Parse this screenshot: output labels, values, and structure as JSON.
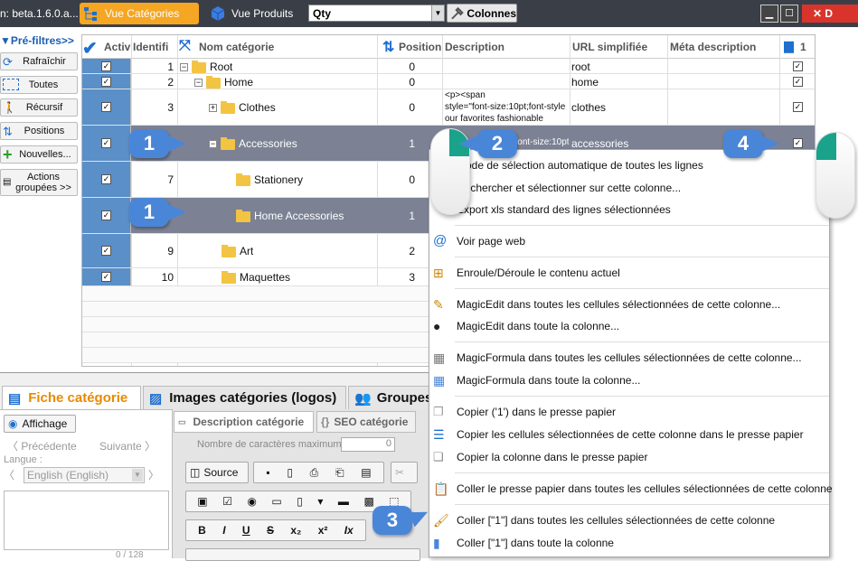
{
  "topbar": {
    "title": "n: beta.1.6.0.a...",
    "view_categories": "Vue Catégories",
    "view_products": "Vue Produits",
    "qty_value": "Qty",
    "columns_button": "Colonnes",
    "close_label": "D"
  },
  "left_panel": {
    "prefilters": "Pré-filtres>>",
    "refresh": "Rafraîchir",
    "all": "Toutes",
    "recursive": "Récursif",
    "positions": "Positions",
    "new": "Nouvelles...",
    "group_actions_1": "Actions",
    "group_actions_2": "groupées >>"
  },
  "grid": {
    "headers": {
      "activ": "Activ",
      "ident": "Identifi",
      "name": "Nom catégorie",
      "position": "Position",
      "description": "Description",
      "url": "URL simplifiée",
      "meta": "Méta description",
      "last": "1"
    },
    "rows": [
      {
        "id": "1",
        "name": "Root",
        "position": "0",
        "description": "",
        "url": "root"
      },
      {
        "id": "2",
        "name": "Home",
        "position": "0",
        "description": "",
        "url": "home"
      },
      {
        "id": "3",
        "name": "Clothes",
        "position": "0",
        "description_l1": "<p><span",
        "description_l2": "style=\"font-size:10pt;font-style",
        "description_l3": "our favorites fashionable",
        "url": "clothes"
      },
      {
        "id": "",
        "name": "Accessories",
        "position": "1",
        "description": "<p><span style=\"font-size:10pt;font-style",
        "url": "accessories"
      },
      {
        "id": "7",
        "name": "Stationery",
        "position": "0",
        "description": "",
        "url": ""
      },
      {
        "id": "",
        "name": "Home Accessories",
        "position": "1",
        "description": "",
        "url": ""
      },
      {
        "id": "9",
        "name": "Art",
        "position": "2",
        "description": "",
        "url": ""
      },
      {
        "id": "10",
        "name": "Maquettes",
        "position": "3",
        "description": "",
        "url": ""
      }
    ]
  },
  "bottom_panel": {
    "tab_fiche": "Fiche catégorie",
    "tab_images": "Images catégories (logos)",
    "tab_groupes": "Groupes",
    "affichage": "Affichage",
    "precedente": "Précédente",
    "suivante": "Suivante",
    "langue_label": "Langue :",
    "langue_value": "English (English)",
    "counter": "0 / 128",
    "subtab_desc": "Description catégorie",
    "subtab_seo": "SEO catégorie",
    "max_chars_label": "Nombre de caractères maximum",
    "max_chars_value": "0",
    "source_button": "Source"
  },
  "context_menu": {
    "items": [
      "Mode de sélection automatique de toutes les lignes",
      "Rechercher et sélectionner sur cette colonne...",
      "Export xls standard des lignes sélectionnées",
      "Voir page web",
      "Enroule/Déroule le contenu actuel",
      "MagicEdit dans toutes les cellules sélectionnées de cette colonne...",
      "MagicEdit dans toute la colonne...",
      "MagicFormula dans toutes les cellules sélectionnées de cette colonne...",
      "MagicFormula dans toute la colonne...",
      "Copier ('1') dans le presse papier",
      "Copier les cellules sélectionnées de cette colonne dans le presse papier",
      "Copier la colonne dans le presse papier",
      "Coller le presse papier dans toutes les cellules sélectionnées de cette colonne",
      "Coller [\"1\"] dans toutes les cellules sélectionnées de cette colonne",
      "Coller [\"1\"] dans toute la colonne"
    ]
  },
  "annotations": {
    "b1": "1",
    "b1b": "1",
    "b2": "2",
    "b3": "3",
    "b4": "4"
  }
}
